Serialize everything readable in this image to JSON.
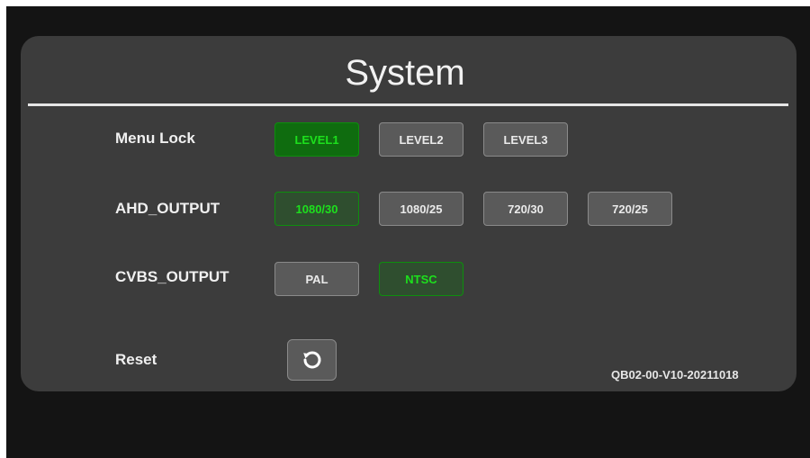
{
  "title": "System",
  "menu_lock": {
    "label": "Menu Lock",
    "options": [
      "LEVEL1",
      "LEVEL2",
      "LEVEL3"
    ],
    "selected": "LEVEL1"
  },
  "ahd_output": {
    "label": "AHD_OUTPUT",
    "options": [
      "1080/30",
      "1080/25",
      "720/30",
      "720/25"
    ],
    "selected": "1080/30"
  },
  "cvbs_output": {
    "label": "CVBS_OUTPUT",
    "options": [
      "PAL",
      "NTSC"
    ],
    "selected": "NTSC"
  },
  "reset": {
    "label": "Reset",
    "icon": "refresh-icon"
  },
  "version": "QB02-00-V10-20211018",
  "colors": {
    "panel": "#3c3c3c",
    "accent_green": "#1de01d",
    "button": "#5a5a5a"
  }
}
